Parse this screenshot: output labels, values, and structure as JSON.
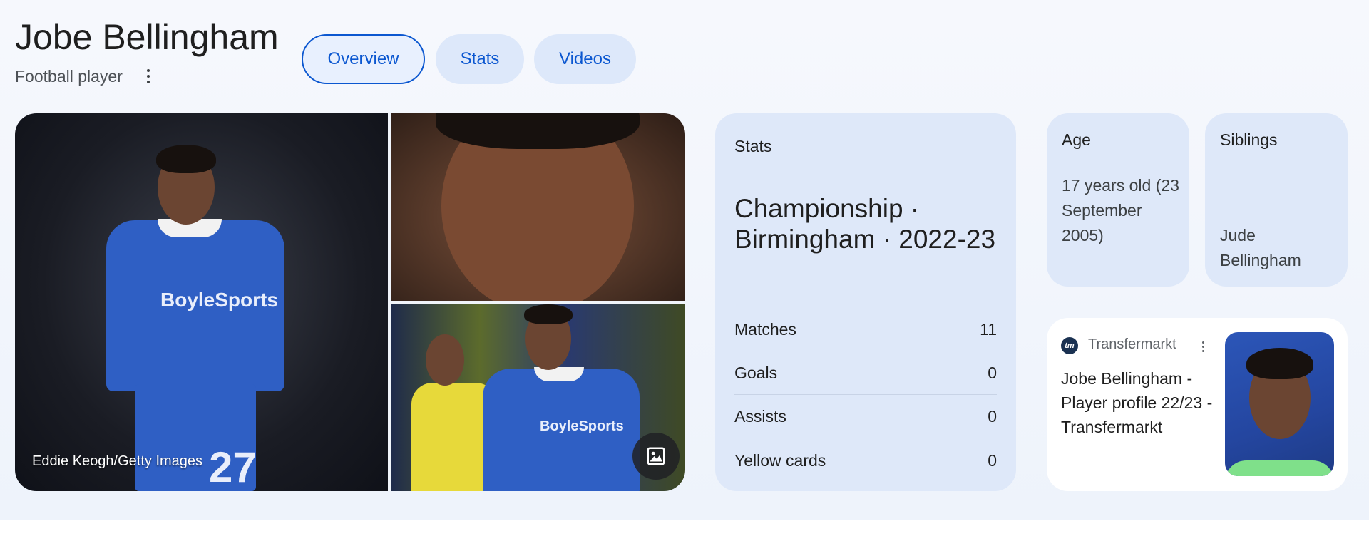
{
  "header": {
    "title": "Jobe Bellingham",
    "subtitle": "Football player",
    "tabs": [
      {
        "label": "Overview",
        "active": true
      },
      {
        "label": "Stats",
        "active": false
      },
      {
        "label": "Videos",
        "active": false
      }
    ]
  },
  "gallery": {
    "credit": "Eddie Keogh/Getty Images",
    "sponsor_text": "BoyleSports",
    "jersey_number": "27",
    "icons": {
      "images_button": "image-icon"
    }
  },
  "stats": {
    "label": "Stats",
    "league": "Championship · Birmingham · 2022-23",
    "rows": [
      {
        "label": "Matches",
        "value": "11"
      },
      {
        "label": "Goals",
        "value": "0"
      },
      {
        "label": "Assists",
        "value": "0"
      },
      {
        "label": "Yellow cards",
        "value": "0"
      }
    ]
  },
  "facts": {
    "age": {
      "label": "Age",
      "value": "17 years old (23 September 2005)"
    },
    "siblings": {
      "label": "Siblings",
      "value": "Jude Bellingham"
    }
  },
  "source": {
    "logo_text": "tm",
    "name": "Transfermarkt",
    "title": "Jobe Bellingham - Player profile 22/23 - Transfermarkt"
  },
  "colors": {
    "accent": "#0b57d0",
    "tab_bg": "#dde8fa",
    "card_bg": "#dee8f9",
    "panel_bg": "#f2f5fc"
  }
}
